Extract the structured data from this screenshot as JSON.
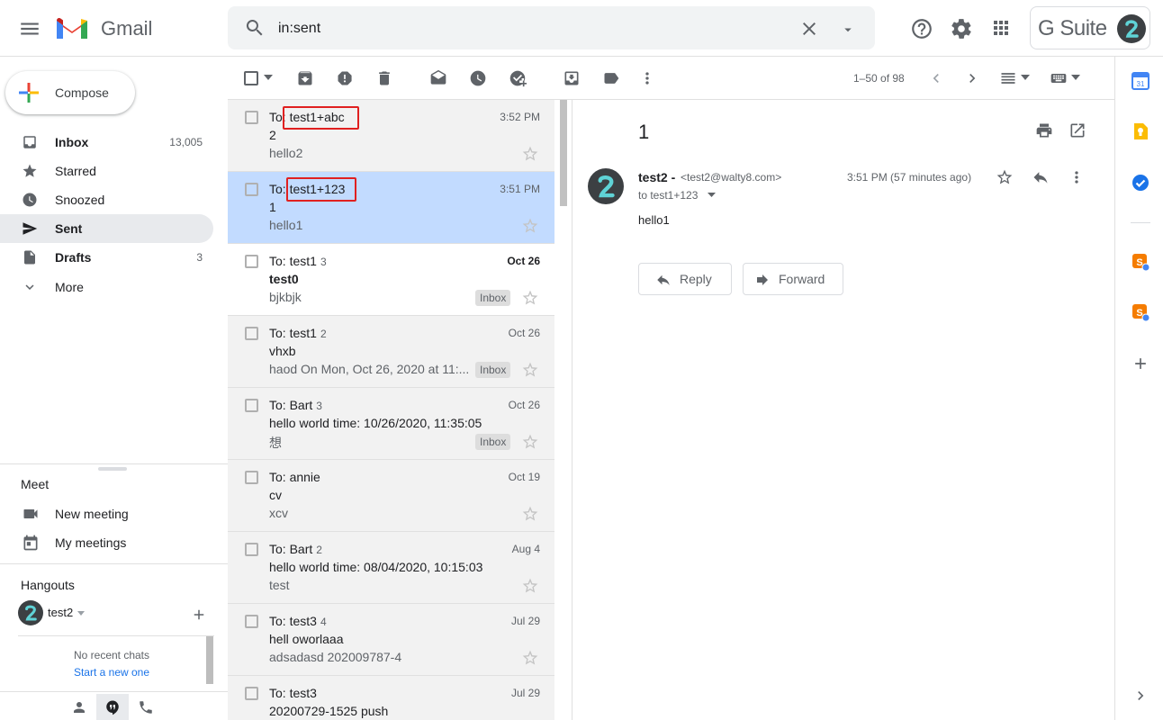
{
  "app": {
    "name": "Gmail",
    "account_badge": "G Suite"
  },
  "search": {
    "value": "in:sent"
  },
  "compose": {
    "label": "Compose"
  },
  "sidebar": {
    "items": [
      {
        "label": "Inbox",
        "count": "13,005",
        "icon": "inbox-icon"
      },
      {
        "label": "Starred",
        "count": "",
        "icon": "star-icon"
      },
      {
        "label": "Snoozed",
        "count": "",
        "icon": "clock-icon"
      },
      {
        "label": "Sent",
        "count": "",
        "icon": "send-icon"
      },
      {
        "label": "Drafts",
        "count": "3",
        "icon": "draft-icon"
      },
      {
        "label": "More",
        "count": "",
        "icon": "chevron-down-icon"
      }
    ]
  },
  "meet": {
    "title": "Meet",
    "items": [
      {
        "label": "New meeting",
        "icon": "videocam-icon"
      },
      {
        "label": "My meetings",
        "icon": "calendar-icon"
      }
    ]
  },
  "hangouts": {
    "title": "Hangouts",
    "user": "test2",
    "no_recent": "No recent chats",
    "start_new": "Start a new one"
  },
  "toolbar": {
    "pagination": "1–50 of 98"
  },
  "emails": [
    {
      "to": "To: ",
      "recipient": "test1+abc",
      "count": "",
      "date": "3:52 PM",
      "subject": "2",
      "snippet": "hello2",
      "badge": "",
      "unread": false,
      "selected": false
    },
    {
      "to": "To: ",
      "recipient": "test1+123",
      "count": "",
      "date": "3:51 PM",
      "subject": "1",
      "snippet": "hello1",
      "badge": "",
      "unread": false,
      "selected": true
    },
    {
      "to": "To: ",
      "recipient": "test1",
      "count": "3",
      "date": "Oct 26",
      "subject": "test0",
      "snippet": "bjkbjk",
      "badge": "Inbox",
      "unread": true,
      "selected": false
    },
    {
      "to": "To: ",
      "recipient": "test1",
      "count": "2",
      "date": "Oct 26",
      "subject": "vhxb",
      "snippet": "haod On Mon, Oct 26, 2020 at 11:...",
      "badge": "Inbox",
      "unread": false,
      "selected": false
    },
    {
      "to": "To: ",
      "recipient": "Bart",
      "count": "3",
      "date": "Oct 26",
      "subject": "hello world time: 10/26/2020, 11:35:05",
      "snippet": "想",
      "badge": "Inbox",
      "unread": false,
      "selected": false
    },
    {
      "to": "To: ",
      "recipient": "annie",
      "count": "",
      "date": "Oct 19",
      "subject": "cv",
      "snippet": "xcv",
      "badge": "",
      "unread": false,
      "selected": false
    },
    {
      "to": "To: ",
      "recipient": "Bart",
      "count": "2",
      "date": "Aug 4",
      "subject": "hello world time: 08/04/2020, 10:15:03",
      "snippet": "test",
      "badge": "",
      "unread": false,
      "selected": false
    },
    {
      "to": "To: ",
      "recipient": "test3",
      "count": "4",
      "date": "Jul 29",
      "subject": "hell oworlaaa",
      "snippet": "adsadasd 202009787-4",
      "badge": "",
      "unread": false,
      "selected": false
    },
    {
      "to": "To: ",
      "recipient": "test3",
      "count": "",
      "date": "Jul 29",
      "subject": "20200729-1525 push",
      "snippet": "",
      "badge": "",
      "unread": false,
      "selected": false
    }
  ],
  "message": {
    "subject": "1",
    "sender_name": "test2 -",
    "sender_email": "<test2@walty8.com>",
    "time": "3:51 PM (57 minutes ago)",
    "to_line": "to test1+123",
    "body": "hello1",
    "reply_label": "Reply",
    "forward_label": "Forward"
  },
  "colors": {
    "accent": "#1a73e8",
    "selected_row": "#c2dbff",
    "highlight_box": "#e02020"
  }
}
